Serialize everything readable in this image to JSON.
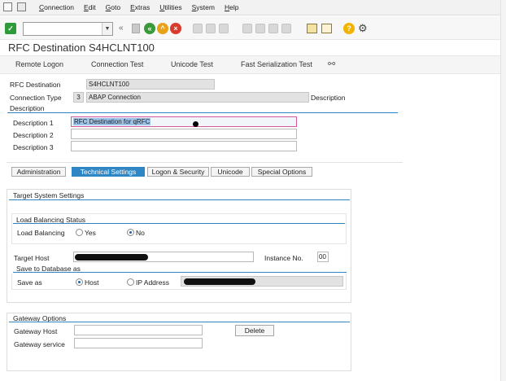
{
  "menu": {
    "items": [
      "Connection",
      "Edit",
      "Goto",
      "Extras",
      "Utilities",
      "System",
      "Help"
    ]
  },
  "title": "RFC Destination S4HCLNT100",
  "app_toolbar": {
    "remote_logon": "Remote Logon",
    "connection_test": "Connection Test",
    "unicode_test": "Unicode Test",
    "fast_serialization_test": "Fast Serialization Test"
  },
  "header": {
    "rfc_destination_label": "RFC Destination",
    "rfc_destination_value": "S4HCLNT100",
    "connection_type_label": "Connection Type",
    "connection_type_code": "3",
    "connection_type_value": "ABAP Connection",
    "connection_type_suffix": "Description"
  },
  "description_group": {
    "title": "Description",
    "description1_label": "Description 1",
    "description1_value": "RFC Destination for qRFC",
    "description2_label": "Description 2",
    "description3_label": "Description 3"
  },
  "tabs": [
    "Administration",
    "Technical Settings",
    "Logon & Security",
    "Unicode",
    "Special Options"
  ],
  "active_tab_index": 1,
  "target_system": {
    "title": "Target System Settings",
    "load_balancing_title": "Load Balancing Status",
    "load_balancing_label": "Load Balancing",
    "yes_label": "Yes",
    "no_label": "No",
    "load_balancing_selected": "No",
    "target_host_label": "Target Host",
    "instance_no_label": "Instance No.",
    "instance_no_value": "00",
    "save_group_title": "Save to Database as",
    "save_as_label": "Save as",
    "host_label": "Host",
    "ip_address_label": "IP Address",
    "save_as_selected": "Host"
  },
  "gateway": {
    "title": "Gateway Options",
    "gateway_host_label": "Gateway Host",
    "gateway_service_label": "Gateway service",
    "delete_label": "Delete"
  },
  "colors": {
    "accent": "#2f86c4",
    "ok_green": "#2e9a3a",
    "back_green": "#3a9a3a",
    "exit_orange": "#e8a21a",
    "cancel_red": "#d93a2b",
    "help_yellow": "#f2b400"
  }
}
